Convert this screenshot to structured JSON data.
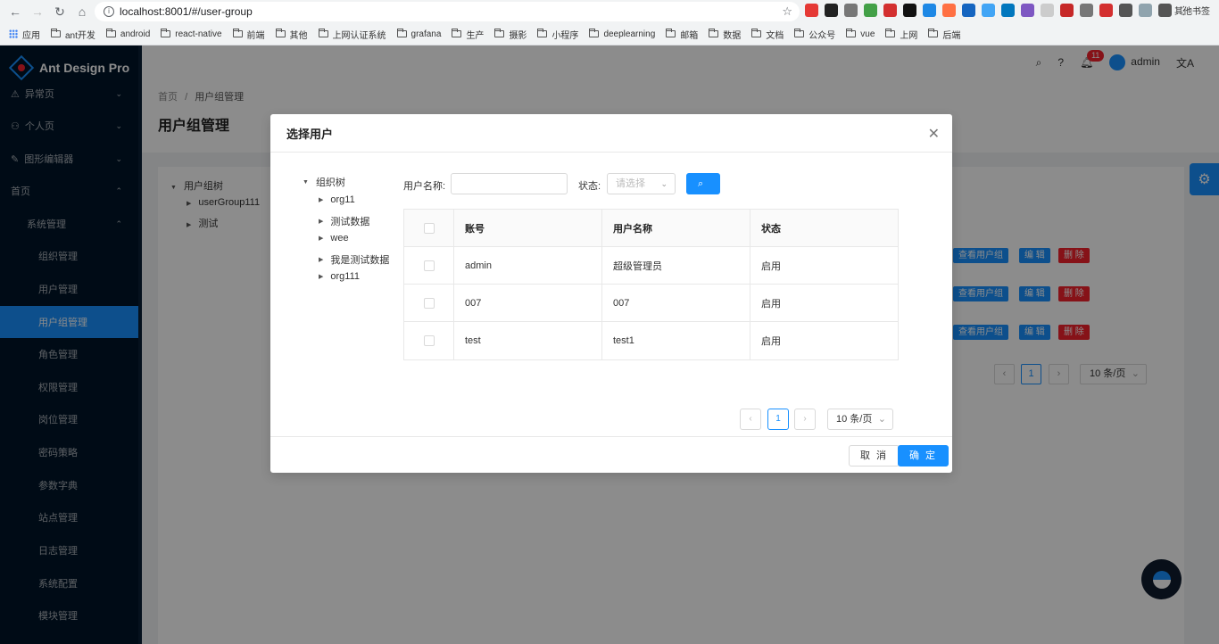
{
  "browser": {
    "url": "localhost:8001/#/user-group",
    "bookmarks": [
      "应用",
      "ant开发",
      "android",
      "react-native",
      "前端",
      "其他",
      "上网认证系统",
      "grafana",
      "生产",
      "摄影",
      "小程序",
      "deeplearning",
      "邮箱",
      "数据",
      "文档",
      "公众号",
      "vue",
      "上网",
      "后端"
    ],
    "other_bookmarks": "其他书签",
    "extension_colors": [
      "#e53935",
      "#222222",
      "#777777",
      "#43a047",
      "#d32f2f",
      "#111111",
      "#1e88e5",
      "#ff7043",
      "#1565c0",
      "#42a5f5",
      "#0277bd",
      "#7e57c2",
      "#cccccc",
      "#c62828",
      "#777777",
      "#d32f2f",
      "#555555",
      "#90a4ae",
      "#555555"
    ]
  },
  "app": {
    "logo": "Ant Design Pro",
    "menu": [
      {
        "label": "异常页",
        "arrow": "⌄"
      },
      {
        "label": "个人页",
        "arrow": "⌄"
      },
      {
        "label": "图形编辑器",
        "arrow": "⌄"
      },
      {
        "label": "首页",
        "arrow": "⌃"
      },
      {
        "label": "系统管理",
        "arrow": "⌃"
      },
      {
        "label": "组织管理"
      },
      {
        "label": "用户管理"
      },
      {
        "label": "用户组管理"
      },
      {
        "label": "角色管理"
      },
      {
        "label": "权限管理"
      },
      {
        "label": "岗位管理"
      },
      {
        "label": "密码策略"
      },
      {
        "label": "参数字典"
      },
      {
        "label": "站点管理"
      },
      {
        "label": "日志管理"
      },
      {
        "label": "系统配置"
      },
      {
        "label": "模块管理"
      }
    ],
    "header": {
      "notification_count": "11",
      "user": "admin"
    },
    "breadcrumb": {
      "home": "首页",
      "sep": "/",
      "current": "用户组管理"
    },
    "page_title": "用户组管理",
    "bg_tree": {
      "root": "用户组树",
      "children": [
        "userGroup111",
        "测试"
      ]
    },
    "bg_actions": {
      "view": "查看用户组",
      "edit": "编 辑",
      "delete": "删 除"
    },
    "bg_pager": {
      "page": "1",
      "size": "10 条/页"
    }
  },
  "modal": {
    "title": "选择用户",
    "tree": {
      "root": "组织树",
      "children": [
        "org11",
        "测试数据",
        "wee",
        "我是测试数据",
        "org111"
      ]
    },
    "search": {
      "name_label": "用户名称:",
      "name_value": "",
      "status_label": "状态:",
      "status_placeholder": "请选择",
      "search_button": "搜索"
    },
    "table": {
      "headers": [
        "账号",
        "用户名称",
        "状态"
      ],
      "rows": [
        {
          "account": "admin",
          "name": "超级管理员",
          "status": "启用"
        },
        {
          "account": "007",
          "name": "007",
          "status": "启用"
        },
        {
          "account": "test",
          "name": "test1",
          "status": "启用"
        }
      ]
    },
    "pagination": {
      "current": "1",
      "size": "10 条/页"
    },
    "footer": {
      "cancel": "取 消",
      "ok": "确 定"
    }
  }
}
